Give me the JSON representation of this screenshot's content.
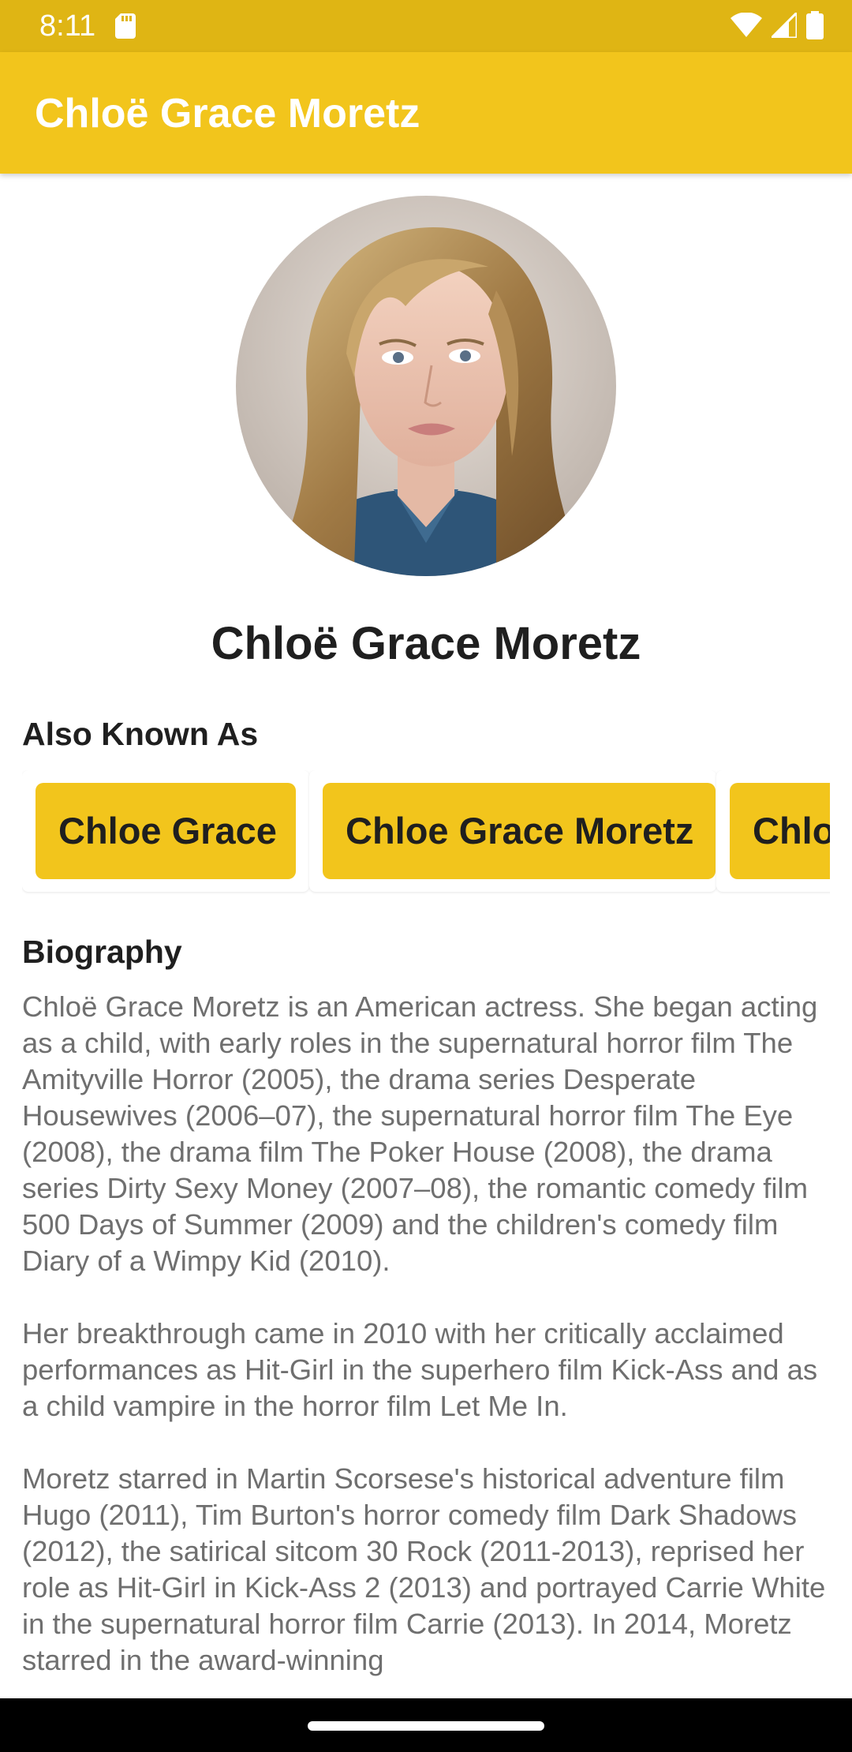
{
  "status_bar": {
    "time": "8:11",
    "background_color": "#dfb514",
    "icons": [
      "sd-card-icon",
      "wifi-icon",
      "cell-signal-icon",
      "battery-icon"
    ]
  },
  "app_bar": {
    "title": "Chloë Grace Moretz",
    "background_color": "#f2c51c"
  },
  "profile": {
    "photo_icon": "profile-photo",
    "name": "Chloë Grace Moretz"
  },
  "also_known_as": {
    "heading": "Also Known As",
    "items": [
      {
        "label": "Chloe Grace"
      },
      {
        "label": "Chloe Grace Moretz"
      },
      {
        "label": "Chlo"
      }
    ],
    "chip_color": "#f2c51c"
  },
  "biography": {
    "heading": "Biography",
    "text": "Chloë Grace Moretz is an American actress. She began acting as a child, with early roles in the supernatural horror film The Amityville Horror (2005), the drama series Desperate Housewives (2006–07), the supernatural horror film The Eye (2008), the drama film The Poker House (2008), the drama series Dirty Sexy Money (2007–08), the romantic comedy film 500 Days of Summer (2009) and the children's comedy film Diary of a Wimpy Kid (2010).\n\nHer breakthrough came in 2010 with her critically acclaimed performances as Hit-Girl in the superhero film Kick-Ass and as a child vampire in the horror film Let Me In.\n\nMoretz starred in Martin Scorsese's historical adventure film Hugo (2011), Tim Burton's horror comedy film Dark Shadows (2012), the satirical sitcom 30 Rock (2011-2013), reprised her role as Hit-Girl in Kick-Ass 2 (2013) and portrayed Carrie White in the supernatural horror film Carrie (2013). In 2014, Moretz starred in the award-winning"
  },
  "nav_bar": {
    "handle_icon": "home-gesture-handle"
  }
}
